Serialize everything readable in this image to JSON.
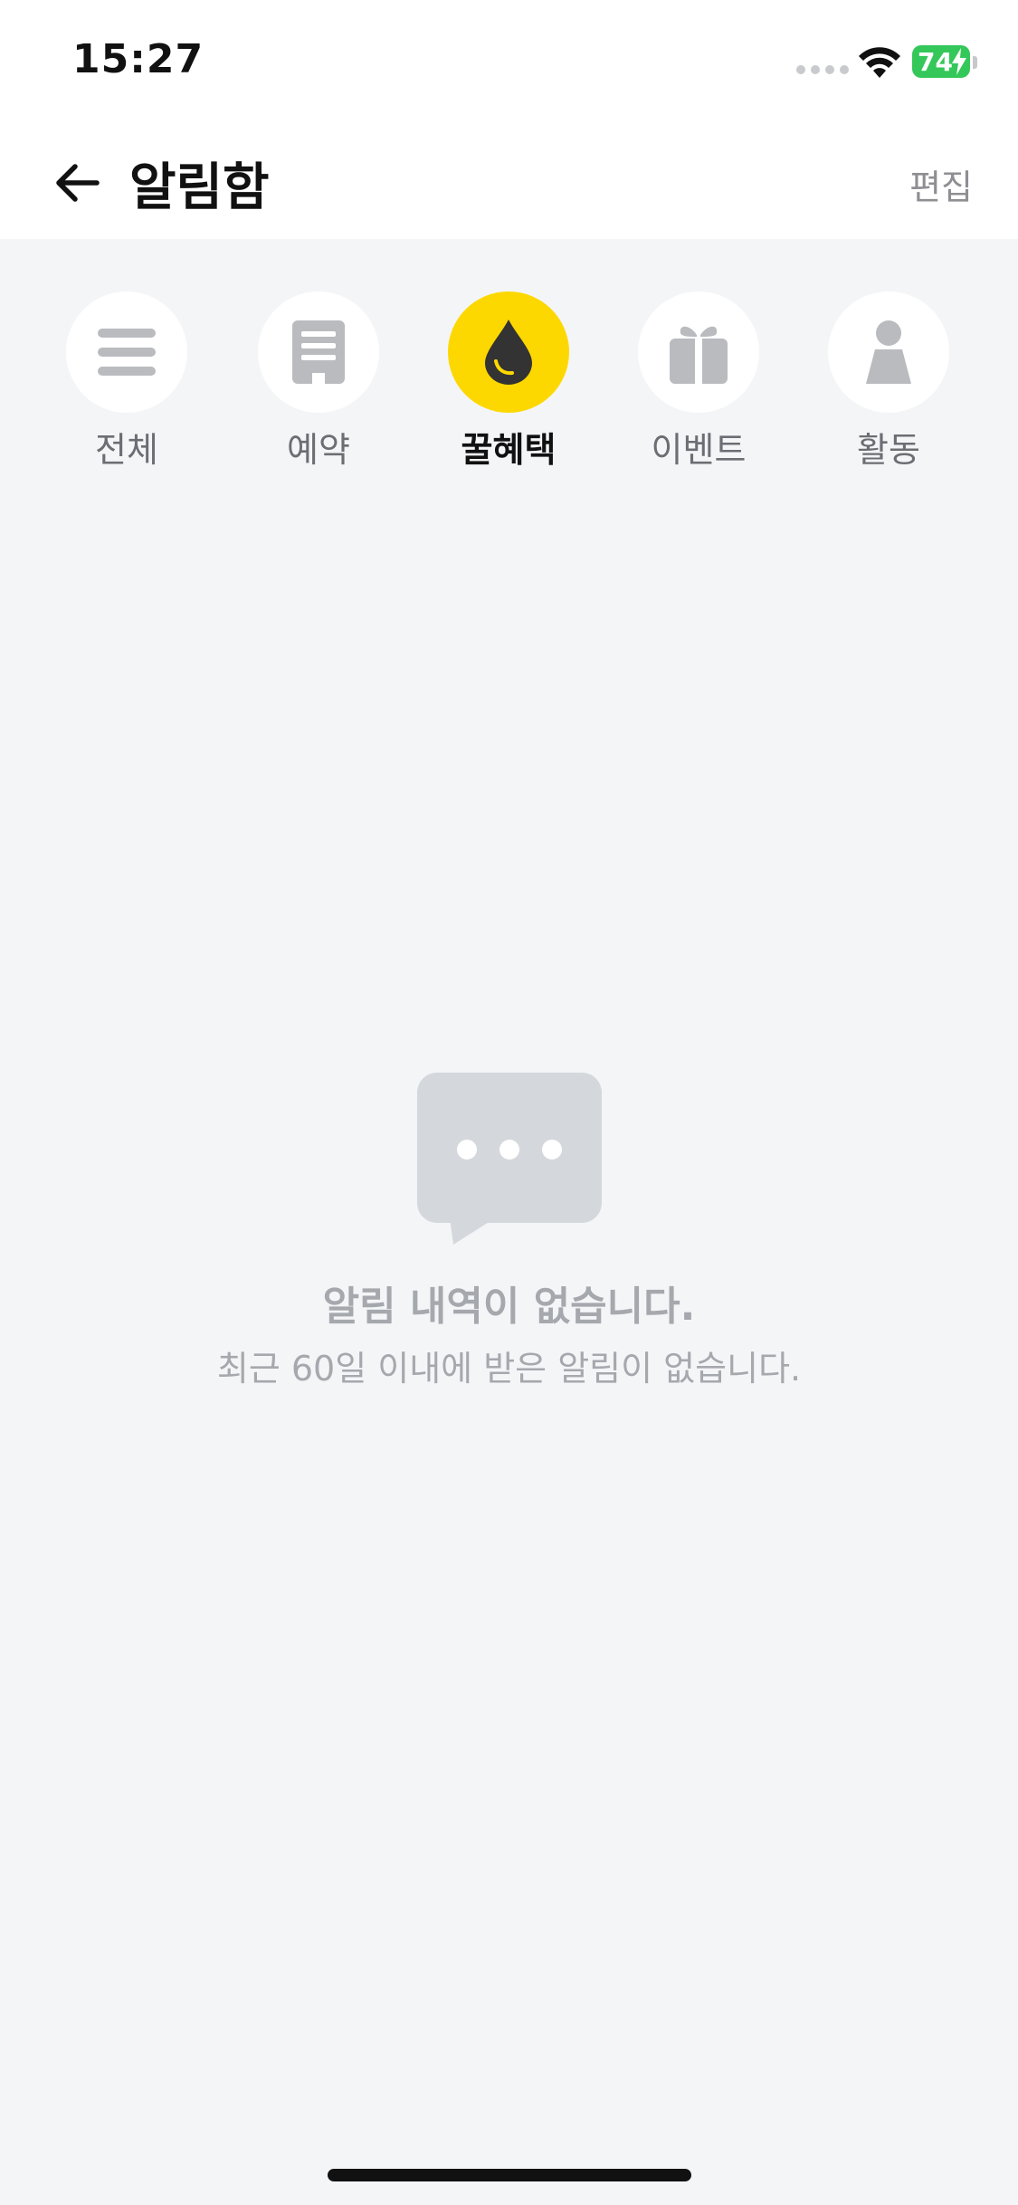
{
  "status_bar": {
    "time": "15:27",
    "battery_level": "74",
    "battery_charging": true
  },
  "header": {
    "back_icon": "arrow-left-icon",
    "title": "알림함",
    "edit_label": "편집"
  },
  "tabs": [
    {
      "label": "전체",
      "icon": "menu-lines-icon",
      "active": false
    },
    {
      "label": "예약",
      "icon": "receipt-icon",
      "active": false
    },
    {
      "label": "꿀혜택",
      "icon": "honey-drop-icon",
      "active": true
    },
    {
      "label": "이벤트",
      "icon": "gift-icon",
      "active": false
    },
    {
      "label": "활동",
      "icon": "person-icon",
      "active": false
    }
  ],
  "empty_state": {
    "icon": "chat-bubble-icon",
    "title": "알림 내역이 없습니다.",
    "subtitle": "최근 60일 이내에 받은 알림이 없습니다."
  },
  "colors": {
    "accent": "#fdd800",
    "background": "#f4f5f7",
    "muted_text": "#a5a8ad",
    "battery": "#34c759"
  }
}
